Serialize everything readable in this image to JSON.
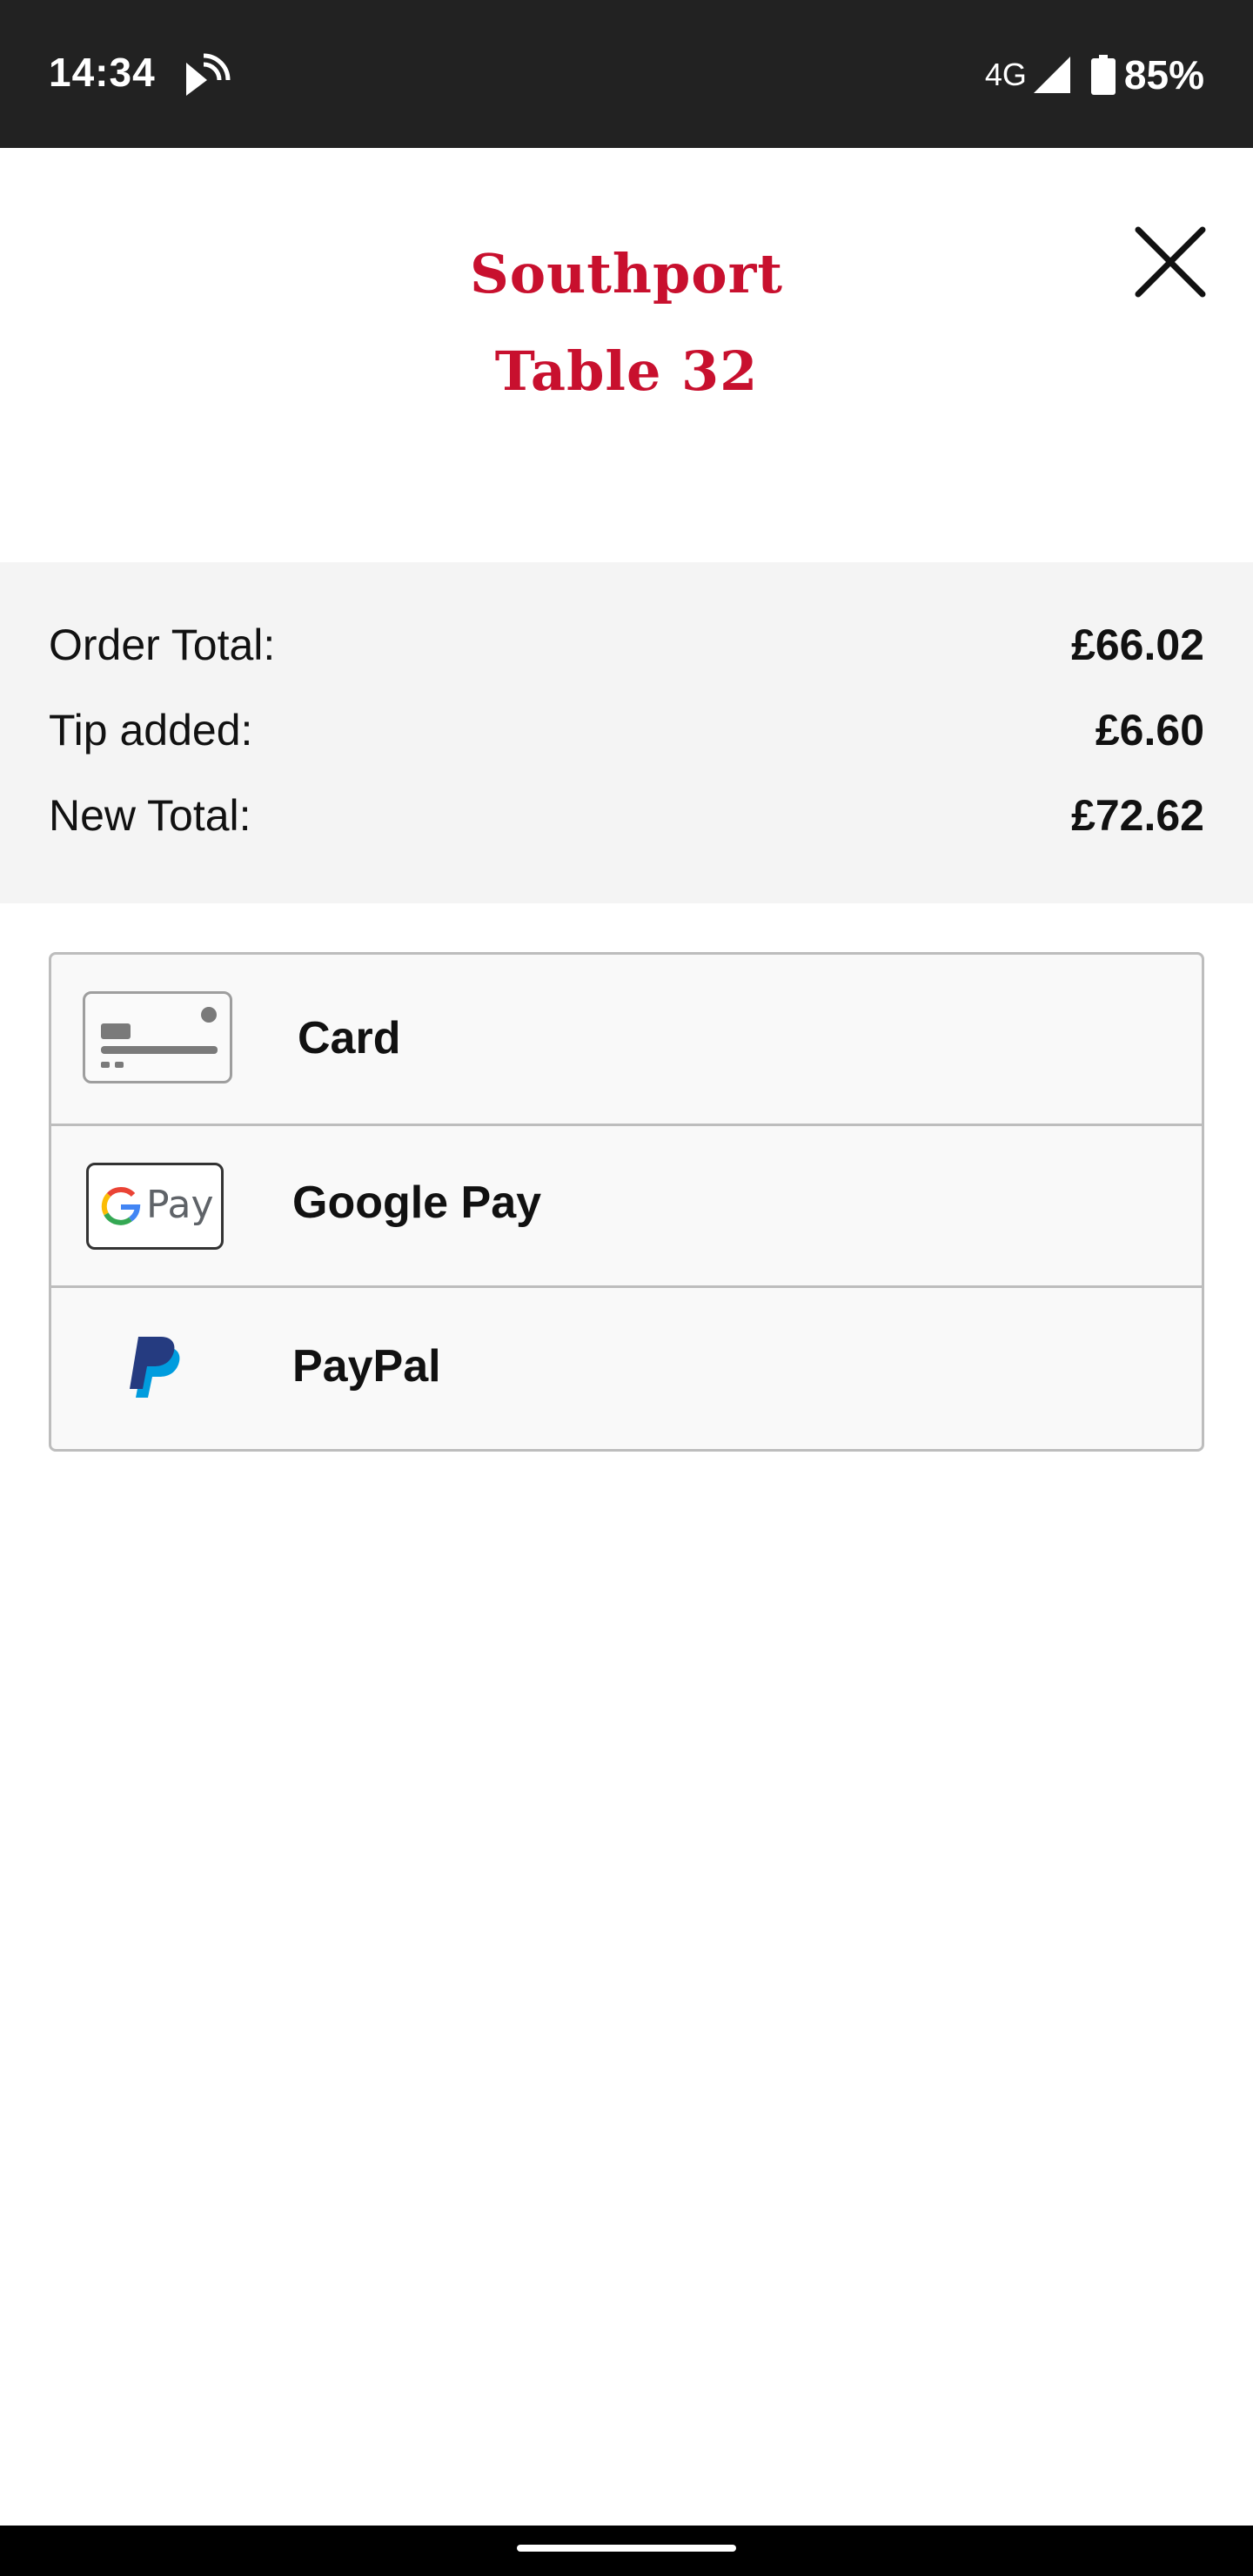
{
  "status_bar": {
    "time": "14:34",
    "network": "4G",
    "battery": "85%",
    "icons": [
      "cast-icon",
      "signal-icon",
      "battery-icon"
    ]
  },
  "header": {
    "venue": "Southport",
    "table": "Table 32",
    "accent_color": "#c8102e",
    "close_icon": "close-icon"
  },
  "summary": {
    "rows": [
      {
        "label": "Order Total:",
        "value": "£66.02"
      },
      {
        "label": "Tip added:",
        "value": "£6.60"
      },
      {
        "label": "New Total:",
        "value": "£72.62"
      }
    ]
  },
  "payment_methods": [
    {
      "label": "Card",
      "icon": "credit-card-icon"
    },
    {
      "label": "Google Pay",
      "icon": "google-pay-icon",
      "icon_text": "Pay"
    },
    {
      "label": "PayPal",
      "icon": "paypal-icon"
    }
  ]
}
